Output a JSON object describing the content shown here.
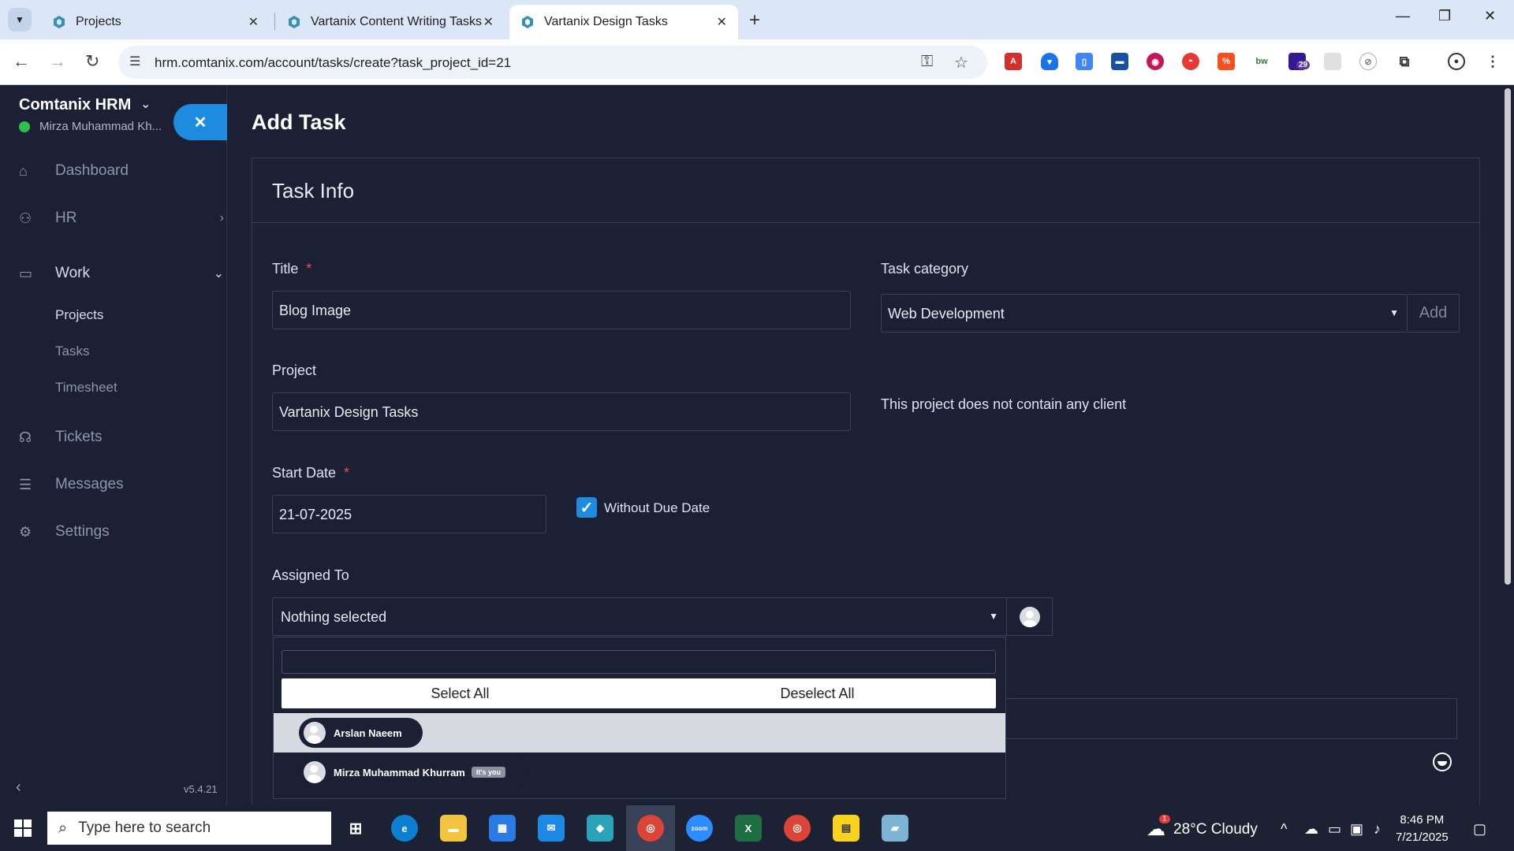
{
  "browser": {
    "tabs": [
      {
        "title": "Projects"
      },
      {
        "title": "Vartanix Content Writing Tasks"
      },
      {
        "title": "Vartanix Design Tasks"
      }
    ],
    "url": "hrm.comtanix.com/account/tasks/create?task_project_id=21",
    "extension_badge": "29"
  },
  "sidebar": {
    "brand": "Comtanix HRM",
    "user_name": "Mirza Muhammad Kh...",
    "items": [
      {
        "label": "Dashboard",
        "icon": "home-icon"
      },
      {
        "label": "HR",
        "icon": "users-icon"
      },
      {
        "label": "Work",
        "icon": "briefcase-icon"
      },
      {
        "label": "Tickets",
        "icon": "headset-icon"
      },
      {
        "label": "Messages",
        "icon": "message-icon"
      },
      {
        "label": "Settings",
        "icon": "gear-icon"
      }
    ],
    "work_sub": [
      {
        "label": "Projects"
      },
      {
        "label": "Tasks"
      },
      {
        "label": "Timesheet"
      }
    ],
    "version": "v5.4.21"
  },
  "page": {
    "title": "Add Task",
    "card_title": "Task Info",
    "form": {
      "title_label": "Title",
      "title_value": "Blog Image",
      "category_label": "Task category",
      "category_value": "Web Development",
      "add_label": "Add",
      "project_label": "Project",
      "project_value": "Vartanix Design Tasks",
      "client_note": "This project does not contain any client",
      "start_date_label": "Start Date",
      "start_date_value": "21-07-2025",
      "without_due_label": "Without Due Date",
      "without_due_checked": true,
      "assigned_label": "Assigned To",
      "assigned_value": "Nothing selected",
      "required_mark": "*"
    },
    "dropdown": {
      "select_all": "Select All",
      "deselect_all": "Deselect All",
      "options": [
        {
          "name": "Arslan Naeem",
          "badge": ""
        },
        {
          "name": "Mirza Muhammad Khurram",
          "badge": "It's you"
        }
      ]
    }
  },
  "taskbar": {
    "search_placeholder": "Type here to search",
    "weather": "28°C  Cloudy",
    "weather_alert": "1",
    "time": "8:46 PM",
    "date": "7/21/2025"
  },
  "colors": {
    "accent": "#1d8ce0",
    "background": "#1b2035",
    "required": "#e64d5a",
    "online": "#2fbf4a"
  }
}
